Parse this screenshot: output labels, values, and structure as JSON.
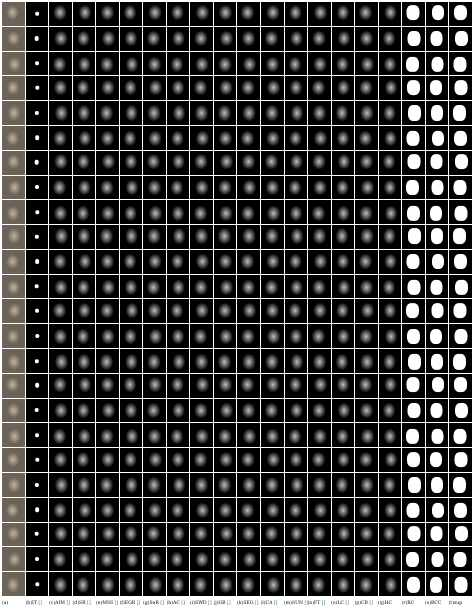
{
  "figure": {
    "rows": 24,
    "columns": [
      {
        "id": "a",
        "text": "(a)",
        "cite": "",
        "kind": "photo"
      },
      {
        "id": "b",
        "text": "(b)IT",
        "cite": "[]",
        "kind": "dot"
      },
      {
        "id": "c",
        "text": "(c)AIM",
        "cite": "[]",
        "kind": "map"
      },
      {
        "id": "d",
        "text": "(d)SR",
        "cite": "[]",
        "kind": "map"
      },
      {
        "id": "e",
        "text": "(e)MSS",
        "cite": "[]",
        "kind": "map"
      },
      {
        "id": "f",
        "text": "(f)EGR",
        "cite": "[]",
        "kind": "map"
      },
      {
        "id": "g",
        "text": "(g)SeR",
        "cite": "[]",
        "kind": "map"
      },
      {
        "id": "h",
        "text": "(h)AC",
        "cite": "[]",
        "kind": "map"
      },
      {
        "id": "i",
        "text": "(i)SWD",
        "cite": "[]",
        "kind": "map"
      },
      {
        "id": "j",
        "text": "(j)GB",
        "cite": "[]",
        "kind": "map"
      },
      {
        "id": "k",
        "text": "(k)SEG",
        "cite": "[]",
        "kind": "map"
      },
      {
        "id": "l",
        "text": "(l)CA",
        "cite": "[]",
        "kind": "map"
      },
      {
        "id": "m",
        "text": "(m)SUN",
        "cite": "[]",
        "kind": "map"
      },
      {
        "id": "n",
        "text": "(n)FT",
        "cite": "[]",
        "kind": "map"
      },
      {
        "id": "o",
        "text": "(o)LC",
        "cite": "[]",
        "kind": "map"
      },
      {
        "id": "p",
        "text": "(p)CB",
        "cite": "[]",
        "kind": "map"
      },
      {
        "id": "q",
        "text": "(q)HC",
        "cite": "",
        "kind": "map"
      },
      {
        "id": "r",
        "text": "(r)RC",
        "cite": "",
        "kind": "bin"
      },
      {
        "id": "s",
        "text": "(s)RCC",
        "cite": "",
        "kind": "bin"
      },
      {
        "id": "t",
        "text": "(t)sup",
        "cite": "",
        "kind": "bin"
      }
    ]
  }
}
